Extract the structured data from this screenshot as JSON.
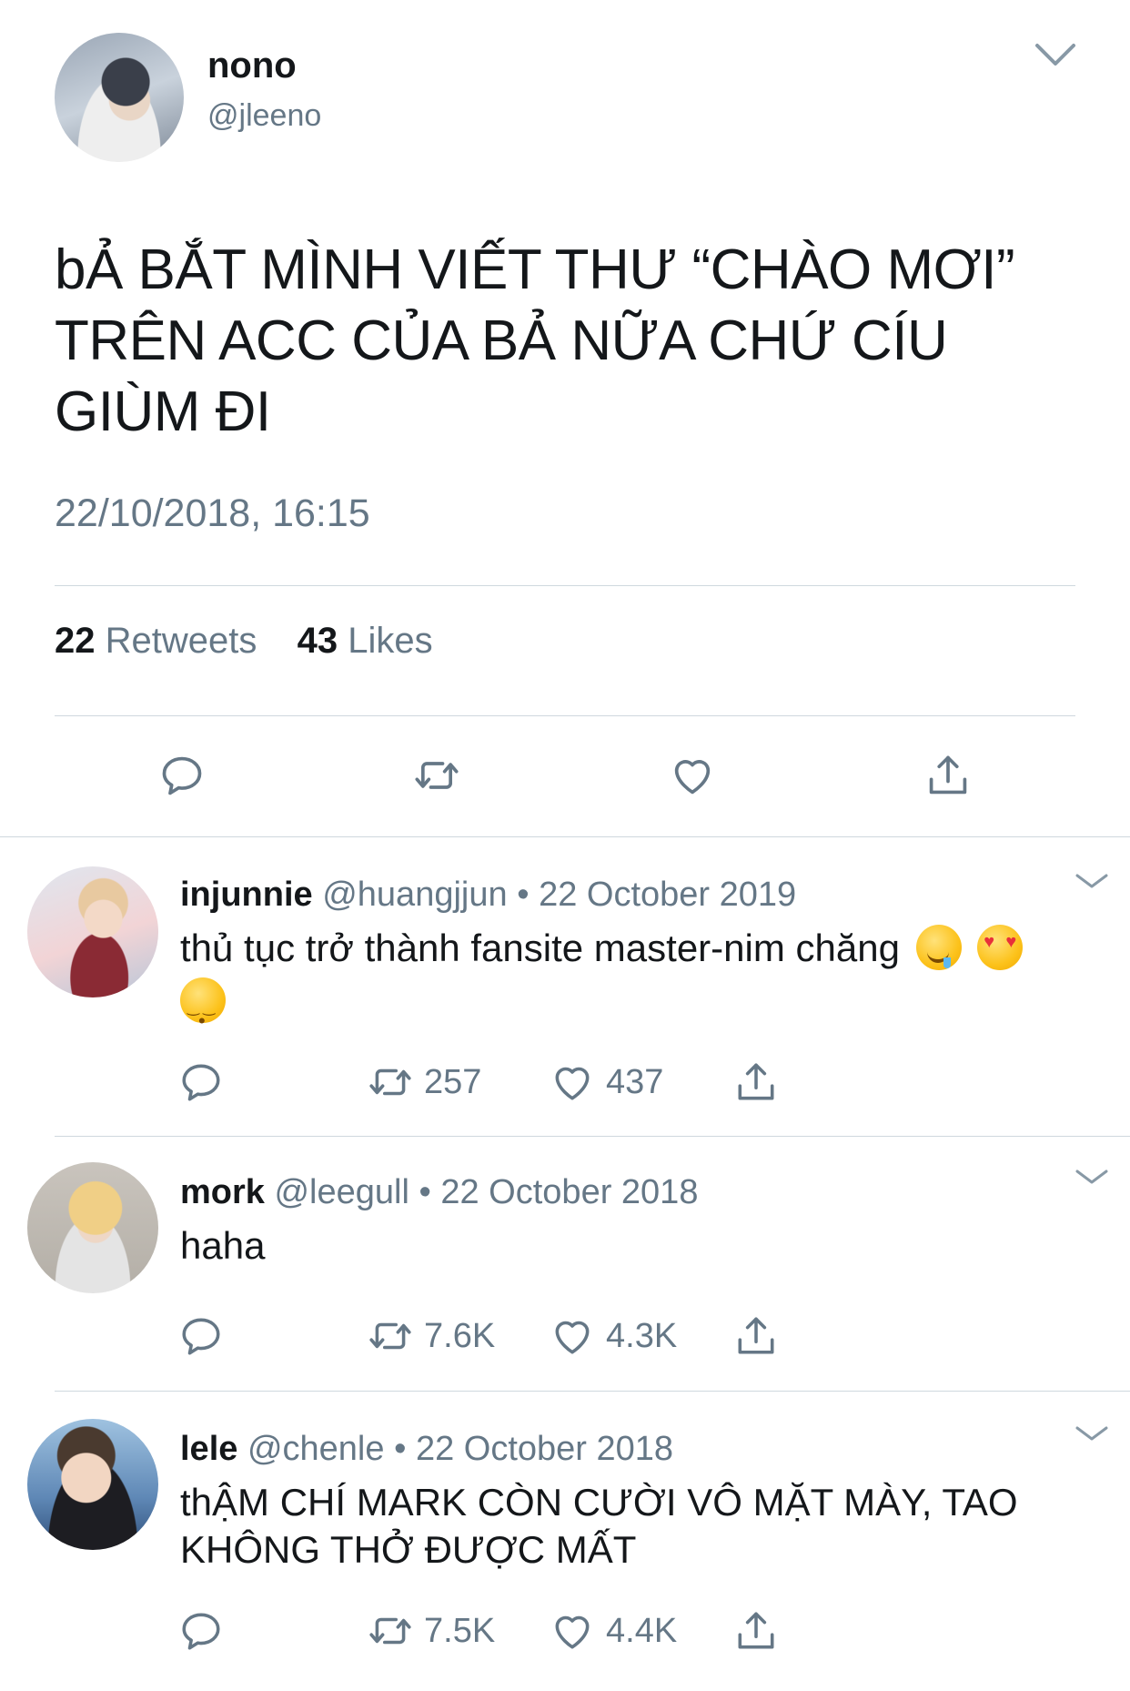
{
  "main": {
    "name": "nono",
    "handle": "@jleeno",
    "text_line1": "bẢ BẮT MÌNH VIẾT THƯ “CHÀO MƠI”",
    "text_line2": "TRÊN ACC CỦA BẢ NỮA CHỨ CÍU",
    "text_line3": "GIÙM ĐI",
    "timestamp": "22/10/2018, 16:15",
    "retweets_count": "22",
    "retweets_label": "Retweets",
    "likes_count": "43",
    "likes_label": "Likes"
  },
  "replies": [
    {
      "name": "injunnie",
      "handle": "@huangjjun",
      "date": "22 October 2019",
      "text": "thủ tục trở thành fansite master-nim chăng",
      "emojis": [
        "drooling-face",
        "heart-eyes",
        "kissing-face"
      ],
      "retweets": "257",
      "likes": "437"
    },
    {
      "name": "mork",
      "handle": "@leegull",
      "date": "22 October 2018",
      "text": "haha",
      "retweets": "7.6K",
      "likes": "4.3K"
    },
    {
      "name": "lele",
      "handle": "@chenle",
      "date": "22 October 2018",
      "text_line1": "thẬM CHÍ MARK CÒN CƯỜI VÔ MẶT MÀY, TAO",
      "text_line2": "KHÔNG THỞ ĐƯỢC MẤT",
      "retweets": "7.5K",
      "likes": "4.4K"
    }
  ],
  "separator": "•",
  "colors": {
    "text": "#14171a",
    "secondary": "#657786",
    "divider": "#cfd8de"
  },
  "icons": [
    "reply-icon",
    "retweet-icon",
    "like-icon",
    "share-icon",
    "chevron-down-icon"
  ]
}
